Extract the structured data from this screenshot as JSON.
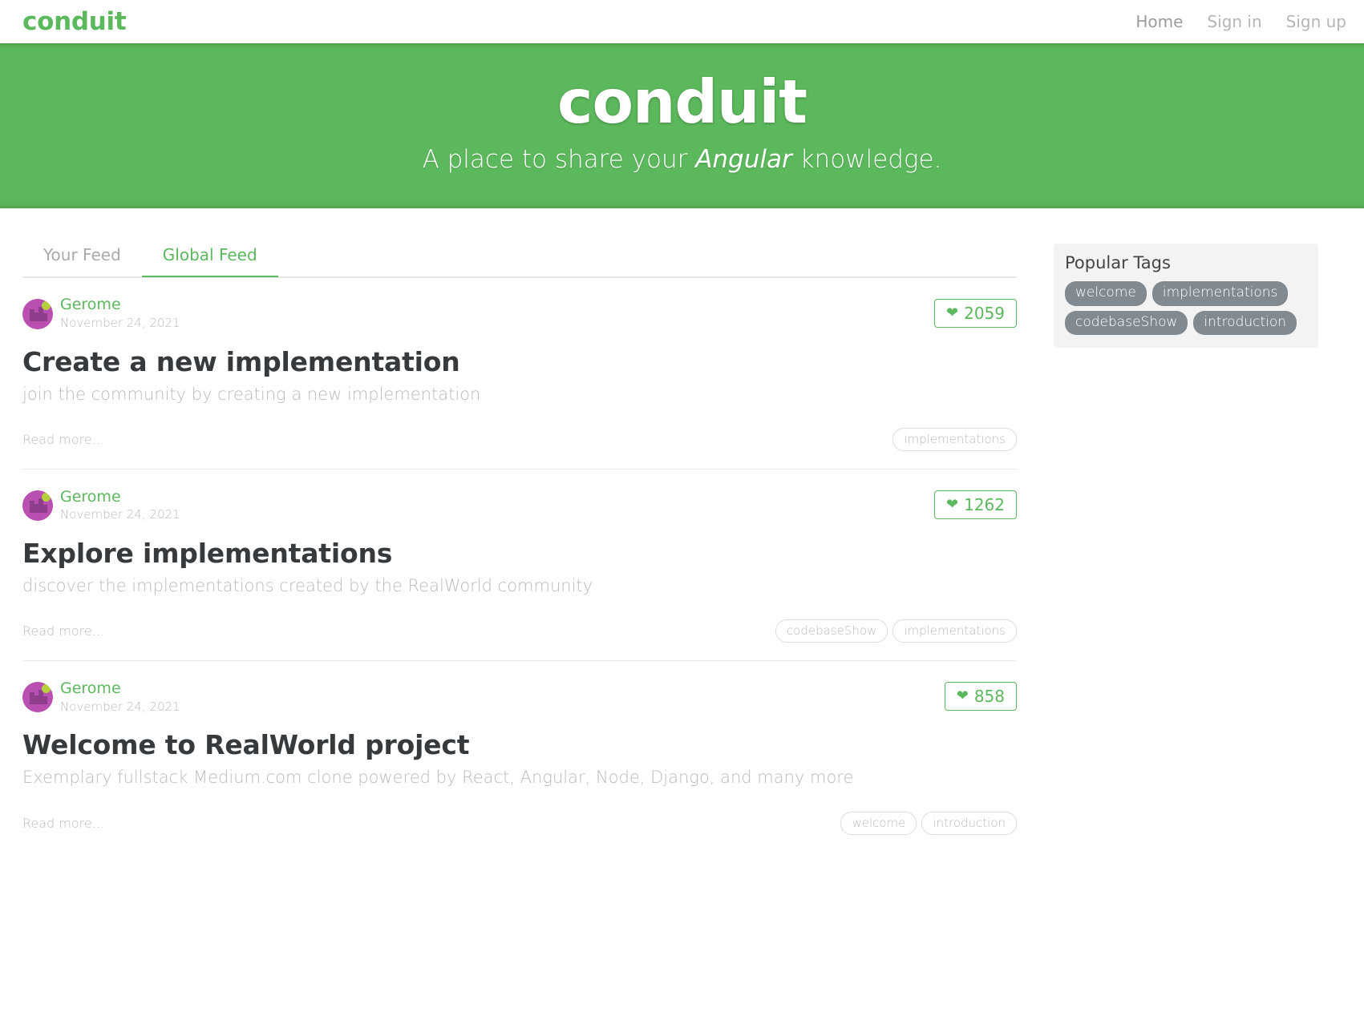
{
  "navbar": {
    "brand": "conduit",
    "links": [
      {
        "label": "Home",
        "active": true
      },
      {
        "label": "Sign in",
        "active": false
      },
      {
        "label": "Sign up",
        "active": false
      }
    ]
  },
  "banner": {
    "title": "conduit",
    "subtitle_before": "A place to share your ",
    "subtitle_emphasis": "Angular",
    "subtitle_after": " knowledge.",
    "bg_color": "#5cb85c"
  },
  "feed_toggle": {
    "tabs": [
      {
        "label": "Your Feed",
        "active": false
      },
      {
        "label": "Global Feed",
        "active": true
      }
    ],
    "active_color": "#5cb85c"
  },
  "articles": [
    {
      "author": "Gerome",
      "date": "November 24, 2021",
      "favorites_count": "2059",
      "heart_icon": "heart-icon",
      "title": "Create a new implementation",
      "description": "join the community by creating a new implementation",
      "read_more": "Read more...",
      "tags": [
        "implementations"
      ]
    },
    {
      "author": "Gerome",
      "date": "November 24, 2021",
      "favorites_count": "1262",
      "heart_icon": "heart-icon",
      "title": "Explore implementations",
      "description": "discover the implementations created by the RealWorld community",
      "read_more": "Read more...",
      "tags": [
        "codebaseShow",
        "implementations"
      ]
    },
    {
      "author": "Gerome",
      "date": "November 24, 2021",
      "favorites_count": "858",
      "heart_icon": "heart-icon",
      "title": "Welcome to RealWorld project",
      "description": "Exemplary fullstack Medium.com clone powered by React, Angular, Node, Django, and many more",
      "read_more": "Read more...",
      "tags": [
        "welcome",
        "introduction"
      ]
    }
  ],
  "sidebar": {
    "title": "Popular Tags",
    "tags": [
      "welcome",
      "implementations",
      "codebaseShow",
      "introduction"
    ],
    "tag_bg": "#818a91",
    "panel_bg": "#f3f3f3"
  }
}
